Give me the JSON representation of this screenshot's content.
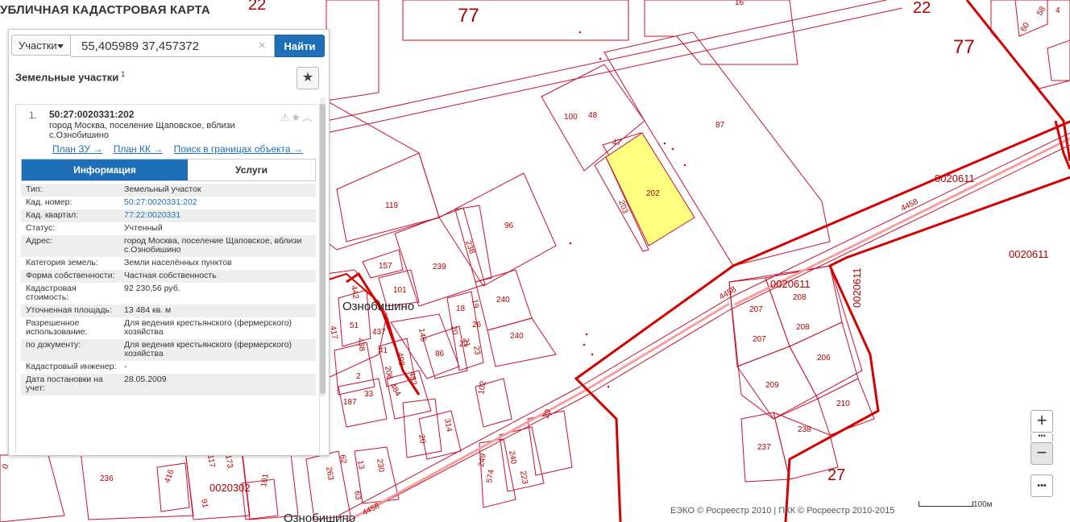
{
  "app": {
    "title": "УБЛИЧНАЯ КАДАСТРОВАЯ КАРТА"
  },
  "search": {
    "type_label": "Участки",
    "value": "55,405989 37,457372",
    "clear": "×",
    "button_label": "Найти"
  },
  "section": {
    "title": "Земельные участки",
    "count": "1",
    "fav_icon": "★"
  },
  "result": {
    "number": "1.",
    "cad_number": "50:27:0020331:202",
    "icons": "⚠★︿",
    "address": "город Москва, поселение Щаповское, вблизи с.Ознобишино",
    "links": {
      "plan_zu": "План ЗУ →",
      "plan_kk": "План КК →",
      "search_in": "Поиск в границах объекта →"
    },
    "tabs": {
      "info": "Информация",
      "services": "Услуги"
    },
    "props": [
      {
        "k": "Тип:",
        "v": "Земельный участок"
      },
      {
        "k": "Кад. номер:",
        "v": "50:27:0020331:202"
      },
      {
        "k": "Кад. квартал:",
        "v": "77:22:0020331"
      },
      {
        "k": "Статус:",
        "v": "Учтенный"
      },
      {
        "k": "Адрес:",
        "v": "город Москва, поселение Щаповское, вблизи с.Ознобишино"
      },
      {
        "k": "Категория земель:",
        "v": "Земли населённых пунктов"
      },
      {
        "k": "Форма собственности:",
        "v": "Частная собственность"
      },
      {
        "k": "Кадастровая стоимость:",
        "v": "92 230,56 руб."
      },
      {
        "k": "Уточненная площадь:",
        "v": "13 484 кв. м"
      },
      {
        "k": "Разрешенное использование:",
        "v": "Для ведения крестьянского (фермерского) хозяйства"
      },
      {
        "k": "по документу:",
        "v": "Для ведения крестьянского (фермерского) хозяйства"
      },
      {
        "k": "Кадастровый инженер:",
        "v": "-"
      },
      {
        "k": "Дата постановки на учет:",
        "v": "28.05.2009"
      }
    ]
  },
  "map_controls": {
    "zoom_in": "+",
    "dots": "•••",
    "zoom_out": "−",
    "more": "•••"
  },
  "footer": {
    "copyright": "ЕЭКО © Росреестр 2010 | ПКК © Росреестр 2010-2015",
    "scale": "100м"
  },
  "map": {
    "labels": {
      "region_77_a": "77",
      "region_77_b": "77",
      "region_22_a": "22",
      "region_22_b": "22",
      "region_27": "27",
      "quarter_0020611_a": "0020611",
      "quarter_0020611_b": "0020611",
      "quarter_0020611_c": "0020611",
      "quarter_0020611_d": "0020611",
      "quarter_0020302": "0020302",
      "village": "Ознобишино",
      "village_bottom": "Ознобишино",
      "road_4458_a": "4458",
      "road_4458_b": "4458",
      "road_4458_c": "4458"
    },
    "parcels": [
      "16",
      "100",
      "48",
      "87",
      "47",
      "202",
      "203",
      "119",
      "96",
      "238",
      "239",
      "157",
      "101",
      "240",
      "240",
      "18",
      "19",
      "26",
      "20",
      "21",
      "22",
      "23",
      "146",
      "86",
      "442",
      "51",
      "437",
      "417",
      "438",
      "41",
      "2",
      "206",
      "498",
      "483",
      "484",
      "187",
      "33",
      "36",
      "102",
      "29",
      "314",
      "20",
      "207",
      "208",
      "207",
      "208",
      "206",
      "209",
      "210",
      "237",
      "238",
      "236",
      "416",
      "0",
      "263",
      "13",
      "230",
      "249",
      "240",
      "223",
      "62",
      "63",
      "101",
      "117",
      "173",
      "91",
      "574",
      "60",
      "58",
      "4"
    ],
    "highlighted_parcel": "202",
    "colors": {
      "boundary": "#d40000",
      "thin": "#c8102e",
      "highlight_fill": "#ffff80",
      "road": "#f4a0a0"
    }
  }
}
